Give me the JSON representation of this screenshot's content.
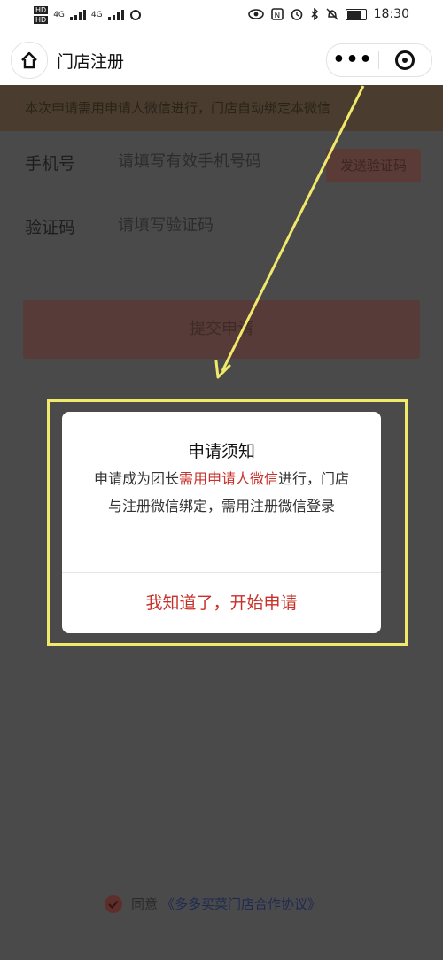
{
  "status_bar": {
    "left_hd1": "HD",
    "left_hd2": "HD",
    "left_net1": "4G",
    "left_net2": "4G",
    "time": "18:30"
  },
  "nav": {
    "title": "门店注册",
    "more": "•••"
  },
  "notice": "本次申请需用申请人微信进行，门店自动绑定本微信",
  "form": {
    "phone_label": "手机号",
    "phone_placeholder": "请填写有效手机号码",
    "code_button": "发送验证码",
    "code_label": "验证码",
    "code_placeholder": "请填写验证码",
    "submit": "提交申请"
  },
  "dialog": {
    "title": "申请须知",
    "body_pre": "申请成为团长",
    "body_red": "需用申请人微信",
    "body_post": "进行，门店与注册微信绑定，需用注册微信登录",
    "action": "我知道了，开始申请"
  },
  "agreement": {
    "text": "同意",
    "link": "《多多买菜门店合作协议》"
  },
  "colors": {
    "accent_red": "#c8302a",
    "highlight_yellow": "#f1e96a"
  }
}
